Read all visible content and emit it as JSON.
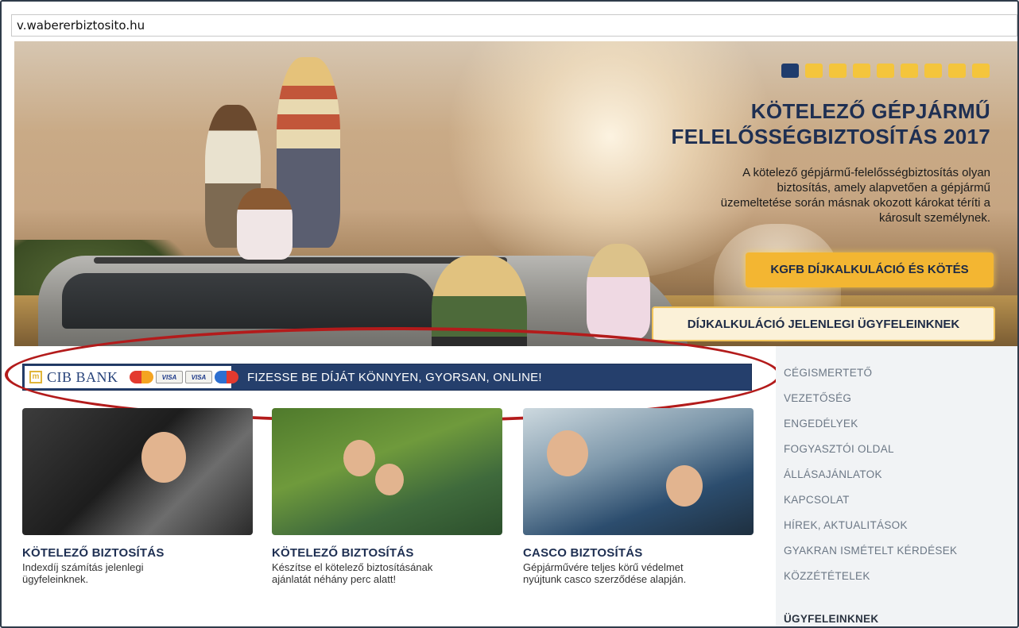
{
  "browser": {
    "url": "v.wabererbiztosito.hu"
  },
  "hero": {
    "slides": {
      "count": 9,
      "active_index": 0
    },
    "title_line1": "KÖTELEZŐ GÉPJÁRMŰ",
    "title_line2": "FELELŐSSÉGBIZTOSÍTÁS 2017",
    "text_lines": [
      "A kötelező gépjármű-felelősségbiztosítás olyan",
      "biztosítás, amely alapvetően a gépjármű",
      "üzemeltetése során másnak okozott károkat téríti a",
      "károsult személynek."
    ],
    "primary_button": "KGFB DÍJKALKULÁCIÓ ÉS KÖTÉS",
    "secondary_button": "DÍJKALKULÁCIÓ JELENLEGI ÜGYFELEINKNEK"
  },
  "cib_banner": {
    "bank_name": "CIB BANK",
    "cards": [
      "MasterCard",
      "VISA",
      "VISA",
      "Maestro"
    ],
    "text": "FIZESSE BE DÍJÁT KÖNNYEN, GYORSAN, ONLINE!"
  },
  "tiles": [
    {
      "title": "KÖTELEZŐ BIZTOSÍTÁS",
      "text_lines": [
        "Indexdíj számítás jelenlegi",
        "ügyfeleinknek."
      ]
    },
    {
      "title": "KÖTELEZŐ BIZTOSÍTÁS",
      "text_lines": [
        "Készítse el kötelező biztosításának",
        "ajánlatát néhány perc alatt!"
      ]
    },
    {
      "title": "CASCO BIZTOSÍTÁS",
      "text_lines": [
        "Gépjárművére teljes körű védelmet",
        "nyújtunk casco szerződése alapján."
      ]
    }
  ],
  "sidebar": {
    "items": [
      "CÉGISMERTETŐ",
      "VEZETŐSÉG",
      "ENGEDÉLYEK",
      "FOGYASZTÓI OLDAL",
      "ÁLLÁSAJÁNLATOK",
      "KAPCSOLAT",
      "HÍREK, AKTUALITÁSOK",
      "GYAKRAN ISMÉTELT KÉRDÉSEK",
      "KÖZZÉTÉTELEK"
    ],
    "section_title": "ÜGYFELEINKNEK"
  },
  "colors": {
    "navy": "#1e2f52",
    "accent_yellow": "#f3b632",
    "banner_blue": "#253f6c",
    "highlight_red": "#b31b1b"
  }
}
